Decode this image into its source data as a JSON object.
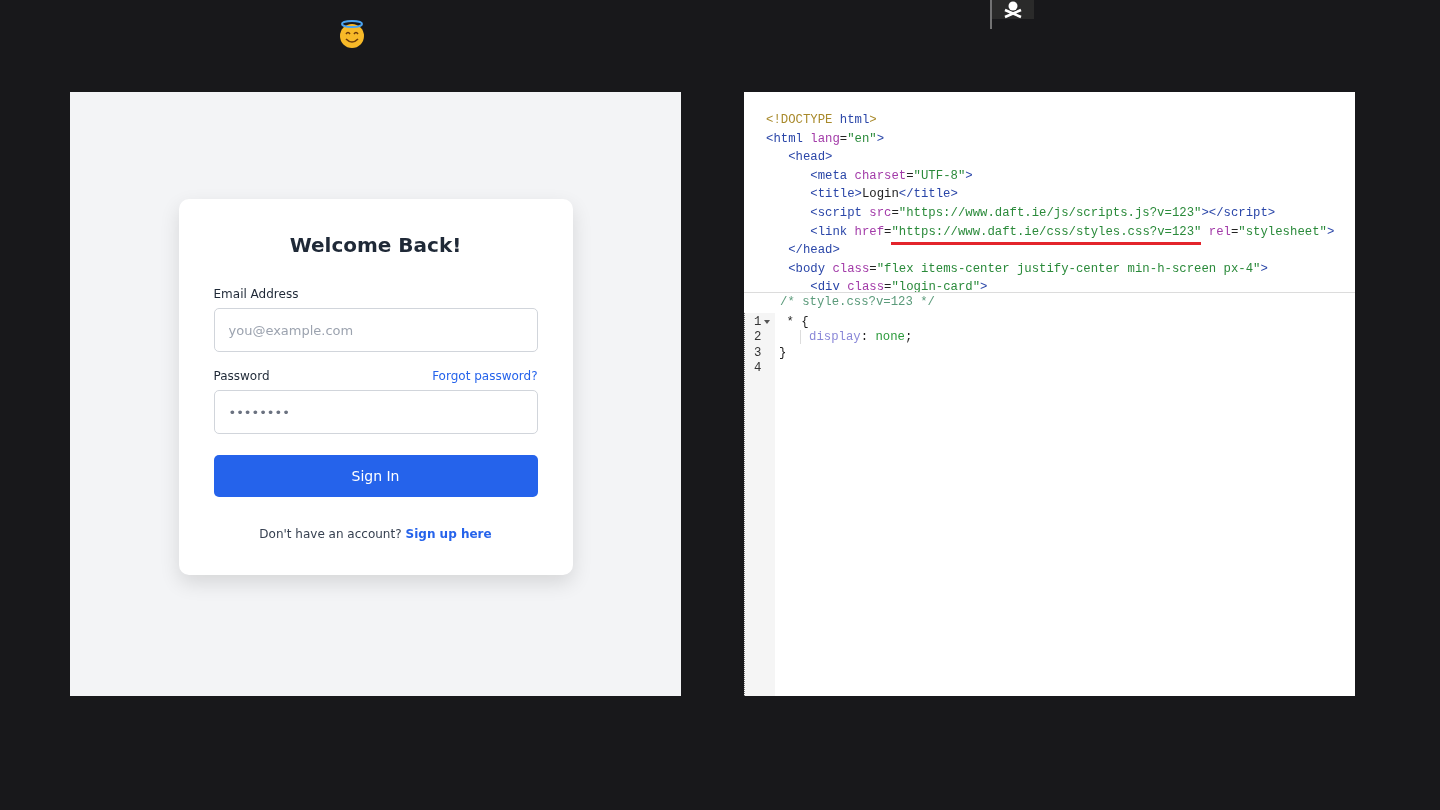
{
  "login": {
    "title": "Welcome Back!",
    "fields": [
      {
        "label": "Email Address",
        "placeholder": "you@example.com"
      },
      {
        "label": "Password",
        "value": "••••••••",
        "link": "Forgot password?"
      }
    ],
    "button": "Sign In",
    "footer": {
      "text": "Don't have an account?",
      "link": "Sign up here"
    }
  },
  "source": {
    "lines": [
      [
        {
          "kind": "doctype",
          "text": "<!DOCTYPE "
        },
        {
          "kind": "tag",
          "text": "html"
        },
        {
          "kind": "doctype",
          "text": ">"
        }
      ],
      [
        {
          "kind": "tag",
          "text": "<html "
        },
        {
          "kind": "attr",
          "text": "lang"
        },
        {
          "kind": "plain",
          "text": "="
        },
        {
          "kind": "string",
          "text": "\"en\""
        },
        {
          "kind": "tag",
          "text": ">"
        }
      ],
      [
        {
          "kind": "tag",
          "text": "   <head>"
        }
      ],
      [
        {
          "kind": "tag",
          "text": "      <meta "
        },
        {
          "kind": "attr",
          "text": "charset"
        },
        {
          "kind": "plain",
          "text": "="
        },
        {
          "kind": "string",
          "text": "\"UTF-8\""
        },
        {
          "kind": "tag",
          "text": ">"
        }
      ],
      [
        {
          "kind": "tag",
          "text": "      <title>"
        },
        {
          "kind": "plain",
          "text": "Login"
        },
        {
          "kind": "tag",
          "text": "</title>"
        }
      ],
      [
        {
          "kind": "tag",
          "text": "      <script "
        },
        {
          "kind": "attr",
          "text": "src"
        },
        {
          "kind": "plain",
          "text": "="
        },
        {
          "kind": "string",
          "text": "\"https://www.daft.ie/js/scripts.js?v=123\""
        },
        {
          "kind": "tag",
          "text": "></script>"
        }
      ],
      [
        {
          "kind": "tag",
          "text": "      <link "
        },
        {
          "kind": "attr",
          "text": "href"
        },
        {
          "kind": "plain",
          "text": "="
        },
        {
          "kind": "string",
          "text": "\"https://www.daft.ie/css/styles.css?v=123\"",
          "underlined": true
        },
        {
          "kind": "attr",
          "text": " rel"
        },
        {
          "kind": "plain",
          "text": "="
        },
        {
          "kind": "string",
          "text": "\"stylesheet\""
        },
        {
          "kind": "tag",
          "text": ">"
        }
      ],
      [
        {
          "kind": "tag",
          "text": "   </head>"
        }
      ],
      [
        {
          "kind": "tag",
          "text": "   <body "
        },
        {
          "kind": "attr",
          "text": "class"
        },
        {
          "kind": "plain",
          "text": "="
        },
        {
          "kind": "string",
          "text": "\"flex items-center justify-center min-h-screen px-4\""
        },
        {
          "kind": "tag",
          "text": ">"
        }
      ],
      [
        {
          "kind": "tag",
          "text": "      <div "
        },
        {
          "kind": "attr",
          "text": "class"
        },
        {
          "kind": "plain",
          "text": "="
        },
        {
          "kind": "string",
          "text": "\"login-card\""
        },
        {
          "kind": "tag",
          "text": ">"
        }
      ]
    ]
  },
  "css_editor": {
    "header": "/* style.css?v=123 */",
    "lines": [
      {
        "number": "1",
        "foldable": true,
        "tokens": [
          {
            "kind": "plain",
            "text": " * {"
          }
        ]
      },
      {
        "number": "2",
        "foldable": false,
        "tokens": [
          {
            "kind": "indent"
          },
          {
            "kind": "property",
            "text": "display"
          },
          {
            "kind": "plain",
            "text": ": "
          },
          {
            "kind": "value",
            "text": "none"
          },
          {
            "kind": "plain",
            "text": ";"
          }
        ]
      },
      {
        "number": "3",
        "foldable": false,
        "tokens": [
          {
            "kind": "plain",
            "text": "}"
          }
        ]
      },
      {
        "number": "4",
        "foldable": false
      }
    ]
  }
}
